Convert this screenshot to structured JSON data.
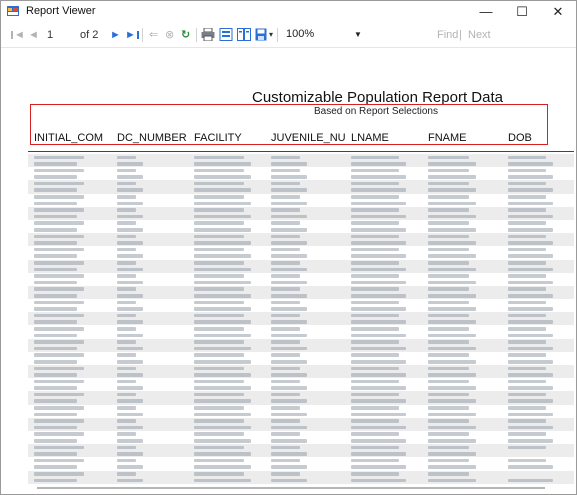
{
  "window": {
    "title": "Report Viewer",
    "minimize": "—",
    "maximize": "☐",
    "close": "✕"
  },
  "toolbar": {
    "first": "◄",
    "prev": "◄",
    "page": "1",
    "of_pages": "of 2",
    "next": "►",
    "last": "►",
    "back": "⇐",
    "stop": "⊗",
    "refresh": "↻",
    "print": "print",
    "print_layout": "print layout",
    "page_setup": "page setup",
    "export": "export",
    "zoom": "100%",
    "find": "Find",
    "find_sep": "|",
    "find_next": "Next"
  },
  "report": {
    "title": "Customizable Population Report Data",
    "subtitle": "Based on Report Selections",
    "columns": [
      "INITIAL_COM",
      "DC_NUMBER",
      "FACILITY",
      "JUVENILE_NU",
      "LNAME",
      "FNAME",
      "DOB"
    ]
  },
  "colors": {
    "highlight": "#d82020",
    "stripe": "#ececec"
  }
}
